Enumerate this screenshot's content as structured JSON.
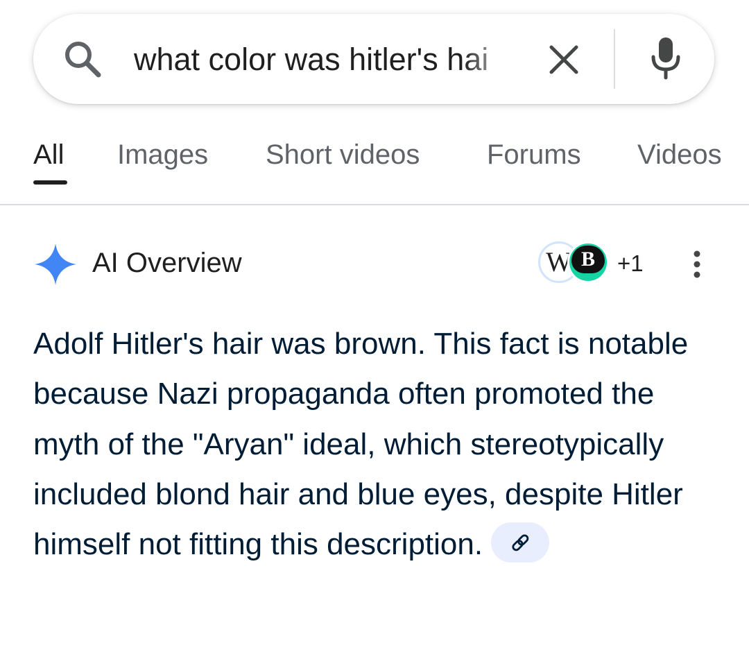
{
  "search": {
    "query": "what color was hitler's hai",
    "icons": [
      "search-icon",
      "close-icon",
      "microphone-icon"
    ]
  },
  "tabs": [
    {
      "label": "All",
      "active": true
    },
    {
      "label": "Images",
      "active": false
    },
    {
      "label": "Short videos",
      "active": false
    },
    {
      "label": "Forums",
      "active": false
    },
    {
      "label": "Videos",
      "active": false
    }
  ],
  "ai_overview": {
    "title": "AI Overview",
    "sources": [
      {
        "letter": "W",
        "icon": "wikipedia-icon"
      },
      {
        "letter": "B",
        "icon": "source-b-icon"
      }
    ],
    "more_sources": "+1",
    "body": "Adolf Hitler's hair was brown. This fact is notable because Nazi propaganda often promoted the myth of the \"Aryan\" ideal, which stereotypically included blond hair and blue eyes, despite Hitler himself not fitting this description.",
    "link_icon": "link-icon"
  },
  "colors": {
    "accent_blue": "#4285f4",
    "body_text": "#001d35",
    "tab_inactive": "#5f6368",
    "link_chip_bg": "#e8eefd",
    "source_b_green": "#15d4a4"
  }
}
